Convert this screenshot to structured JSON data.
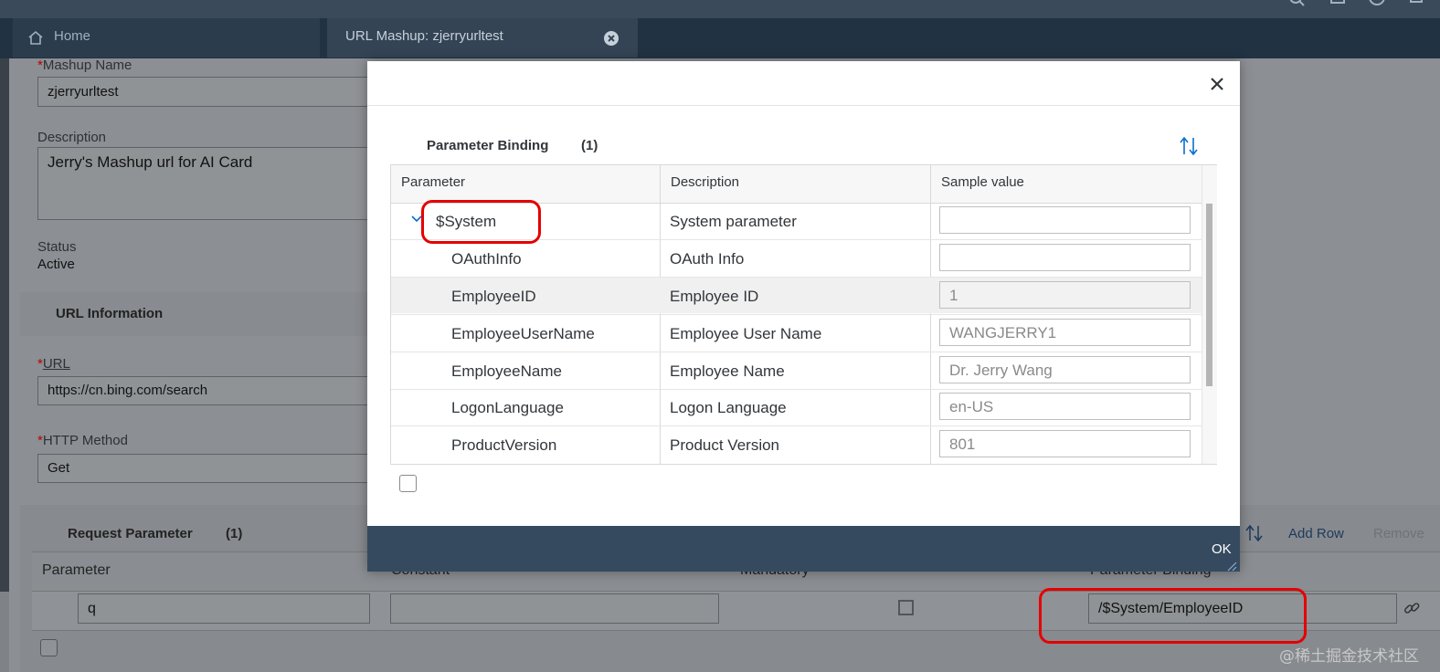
{
  "tabs": [
    {
      "label": "Home"
    },
    {
      "label": "URL Mashup: zjerryurltest"
    }
  ],
  "form": {
    "mashup_name_label": "Mashup Name",
    "mashup_name_value": "zjerryurltest",
    "description_label": "Description",
    "description_value": "Jerry's Mashup url for AI Card",
    "status_label": "Status",
    "status_value": "Active",
    "url_info_title": "URL Information",
    "url_label": "URL",
    "url_value": "https://cn.bing.com/search",
    "http_method_label": "HTTP Method",
    "http_method_value": "Get",
    "required_marker": "*"
  },
  "request_parameter": {
    "title": "Request Parameter",
    "count": "(1)",
    "add_row": "Add Row",
    "remove": "Remove",
    "columns": [
      "Parameter",
      "Constant",
      "Mandatory",
      "Parameter Binding"
    ],
    "row": {
      "parameter": "q",
      "constant": "",
      "binding": "/$System/EmployeeID"
    }
  },
  "dialog": {
    "section_title": "Parameter Binding",
    "count": "(1)",
    "columns": [
      "Parameter",
      "Description",
      "Sample value"
    ],
    "rows": [
      {
        "parameter": "$System",
        "description": "System parameter",
        "sample": ""
      },
      {
        "parameter": "OAuthInfo",
        "description": "OAuth Info",
        "sample": ""
      },
      {
        "parameter": "EmployeeID",
        "description": "Employee ID",
        "sample": "1"
      },
      {
        "parameter": "EmployeeUserName",
        "description": "Employee User Name",
        "sample": "WANGJERRY1"
      },
      {
        "parameter": "EmployeeName",
        "description": "Employee Name",
        "sample": "Dr. Jerry Wang"
      },
      {
        "parameter": "LogonLanguage",
        "description": "Logon Language",
        "sample": "en-US"
      },
      {
        "parameter": "ProductVersion",
        "description": "Product Version",
        "sample": "801"
      }
    ],
    "ok_label": "OK"
  },
  "watermark": "@稀土掘金技术社区",
  "colors": {
    "highlight": "#e50000",
    "shell": "#213243",
    "dialog_footer": "#354a5f",
    "link": "#0a6ed1"
  },
  "icons": [
    "home-icon",
    "close-tab-icon",
    "close-icon",
    "sort-icon",
    "chevron-down-icon",
    "link-icon",
    "search-icon",
    "bell-icon"
  ]
}
